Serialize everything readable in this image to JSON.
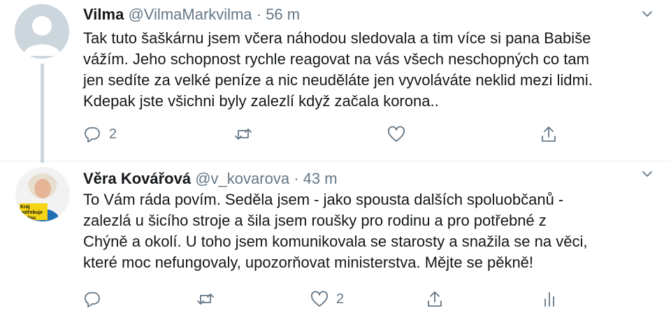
{
  "tweets": [
    {
      "name": "Vilma",
      "handle": "@VilmaMarkvilma",
      "separator": "·",
      "time": "56 m",
      "text": "Tak tuto šaškárnu jsem včera náhodou sledovala a tim více si pana Babiše\nvážím. Jeho schopnost rychle reagovat na vás všech neschopných co tam\njen sedíte za velké peníze a nic neuděláte jen vyvoláváte neklid mezi lidmi.\nKdepak jste všichni byly zalezlí když začala korona..",
      "reply_count": "2",
      "retweet_count": "",
      "like_count": ""
    },
    {
      "name": "Věra Kovářová",
      "handle": "@v_kovarova",
      "separator": "·",
      "time": "43 m",
      "text": "To Vám ráda povím. Seděla jsem - jako spousta dalších spoluobčanů -\nzalezlá u šicího stroje a šila jsem roušky pro rodinu a pro potřebné z\nChýně a okolí. U toho jsem komunikovala se starosty a snažila se na věci,\nkteré moc nefungovaly, upozorňovat ministerstva. Mějte se pěkně!",
      "reply_count": "",
      "retweet_count": "",
      "like_count": "2",
      "avatar_badge": "Kraj potřebuje změnu"
    }
  ],
  "icons": {
    "reply": "reply-icon",
    "retweet": "retweet-icon",
    "like": "heart-icon",
    "share": "share-icon",
    "analytics": "analytics-icon",
    "caret": "chevron-down-icon"
  },
  "colors": {
    "icon_gray": "#657786",
    "text": "#14171a",
    "divider": "#e6ecf0",
    "badge_yellow": "#f5d416"
  }
}
